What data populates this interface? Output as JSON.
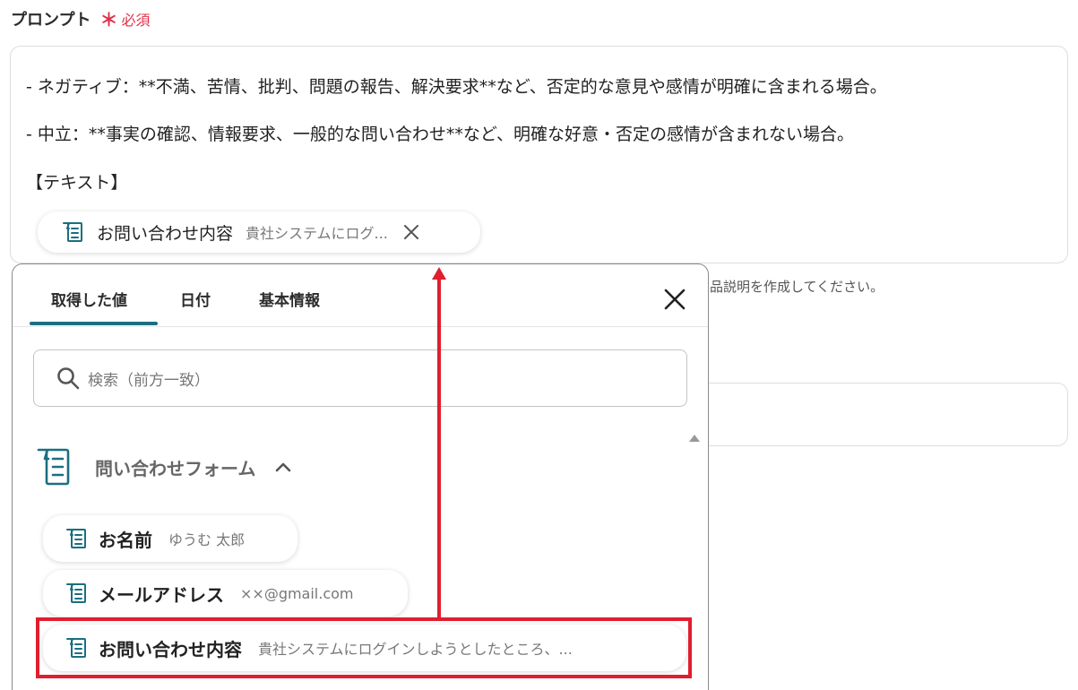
{
  "field": {
    "label": "プロンプト",
    "required_mark": "＊",
    "required_text": "必須"
  },
  "prompt": {
    "lines": [
      "- ネガティブ：**不満、苦情、批判、問題の報告、解決要求**など、否定的な意見や感情が明確に含まれる場合。",
      "- 中立：**事実の確認、情報要求、一般的な問い合わせ**など、明確な好意・否定の感情が含まれない場合。",
      "【テキスト】"
    ],
    "inserted_chip": {
      "icon": "form-icon",
      "title": "お問い合わせ内容",
      "value": "貴社システムにログ..."
    }
  },
  "hint": {
    "text": "品説明を作成してください。"
  },
  "panel": {
    "tabs": [
      {
        "label": "取得した値",
        "active": true
      },
      {
        "label": "日付",
        "active": false
      },
      {
        "label": "基本情報",
        "active": false
      }
    ],
    "search_placeholder": "検索（前方一致）",
    "group": {
      "icon": "form-large-icon",
      "title": "問い合わせフォーム",
      "expanded": true
    },
    "items": [
      {
        "icon": "form-icon",
        "title": "お名前",
        "value": "ゆうむ 太郎"
      },
      {
        "icon": "form-icon",
        "title": "メールアドレス",
        "value": "××@gmail.com"
      },
      {
        "icon": "form-icon",
        "title": "お問い合わせ内容",
        "value": "貴社システムにログインしようとしたところ、..."
      }
    ]
  },
  "colors": {
    "accent": "#1a6f80",
    "required": "#e0304a",
    "annotation": "#e01e2e"
  }
}
